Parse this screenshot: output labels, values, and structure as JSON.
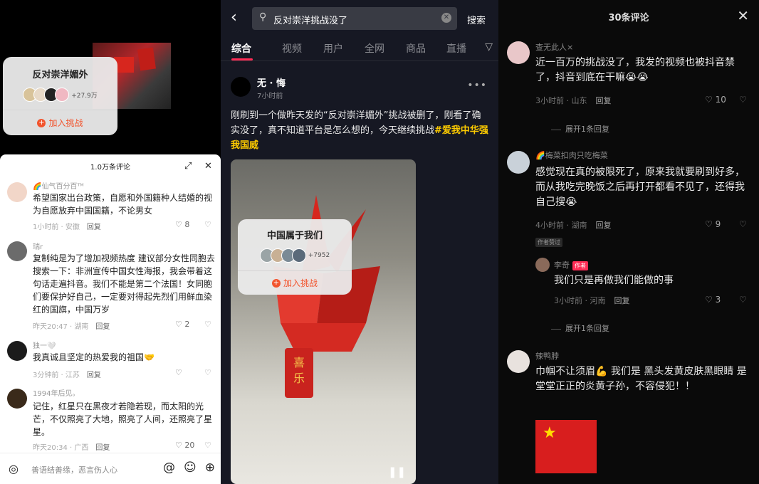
{
  "left": {
    "challenge": {
      "title": "反对崇洋媚外",
      "count": "+27.9万",
      "join": "加入挑战"
    },
    "sheet_title": "1.0万条评论",
    "comments": [
      {
        "name": "🌈仙气百分百ᵀᴹ",
        "text": "希望国家出台政策，自愿和外国籍种人结婚的视为自愿放弃中国国籍，不论男女",
        "time": "1小时前 · 安徽",
        "reply": "回复",
        "likes": "8"
      },
      {
        "name": "瑞r",
        "text": "复制纯是为了增加视频热度 建议部分女性同胞去搜索一下：非洲宣传中国女性海报，我会带着这句话走遍抖音。我们不能是第二个法国！女同胞们要保护好自己，一定要对得起先烈们用鲜血染红的国旗，中国万岁",
        "time": "昨天20:47 · 湖南",
        "reply": "回复",
        "likes": "2"
      },
      {
        "name": "独一🤍",
        "text": "我真诚且坚定的热爱我的祖国🤝",
        "time": "3分钟前 · 江苏",
        "reply": "回复",
        "likes": ""
      },
      {
        "name": "1994年后见。",
        "text": "记住，红星只在黑夜才若隐若现，而太阳的光芒，不仅照亮了大地，照亮了人间，还照亮了星星。",
        "time": "昨天20:34 · 广西",
        "reply": "回复",
        "likes": "20"
      }
    ],
    "input_placeholder": "善语结善缘，恶言伤人心"
  },
  "middle": {
    "search_query": "反对崇洋挑战没了",
    "search_button": "搜索",
    "tabs": [
      "综合",
      "视频",
      "用户",
      "全网",
      "商品",
      "直播"
    ],
    "post": {
      "author": "无 · 悔",
      "time": "7小时前",
      "text": "刚刷到一个做昨天发的“反对崇洋媚外”挑战被删了，刚看了确实没了，真不知道平台是怎么想的，今天继续挑战",
      "hashtag": "#爱我中华强我国威"
    },
    "challenge": {
      "title": "中国属于我们",
      "count": "+7952",
      "join": "加入挑战"
    },
    "tag_text": "喜乐"
  },
  "right": {
    "title": "30条评论",
    "comments": [
      {
        "name": "查无此人×",
        "text": "近一百万的挑战没了，我发的视频也被抖音禁了，抖音到底在干嘛😭😭",
        "time": "3小时前 · 山东",
        "reply": "回复",
        "likes": "10",
        "expand": "展开1条回复"
      },
      {
        "name": "🌈梅菜扣肉只吃梅菜",
        "text": "感觉现在真的被限死了，原来我就要刷到好多，而从我吃完晚饭之后再打开都看不见了，还得我自己搜😭",
        "time": "4小时前 · 湖南",
        "reply": "回复",
        "likes": "9",
        "badge": "作者赞过"
      },
      {
        "name": "李奇",
        "author_tag": "作者",
        "text": "我们只是再做我们能做的事",
        "time": "3小时前 · 河南",
        "reply": "回复",
        "likes": "3",
        "expand": "展开1条回复"
      },
      {
        "name": "辣鸭脖",
        "text": "巾帼不让须眉💪 我们是 黑头发黄皮肤黑眼睛 是堂堂正正的炎黄子孙，不容侵犯！！"
      }
    ]
  }
}
